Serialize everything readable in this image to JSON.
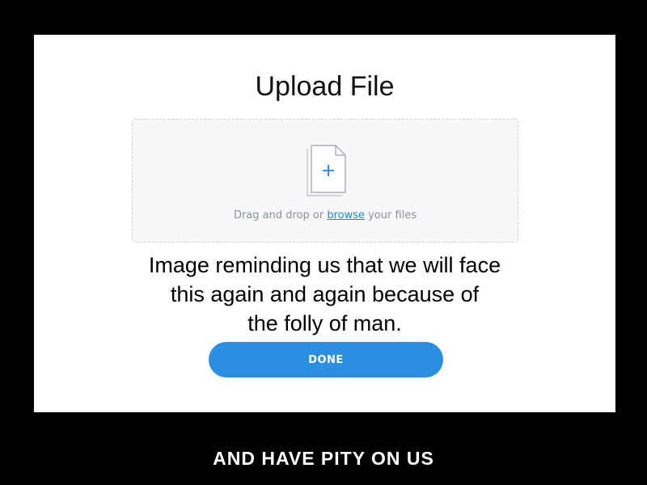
{
  "dialog": {
    "title": "Upload File",
    "dropzone": {
      "icon": "file-add-icon",
      "text_before": "Drag and drop or ",
      "browse_link": "browse",
      "text_after": " your files"
    },
    "overlay_caption": {
      "line1": "Image reminding us that we will face",
      "line2": "this again and again because of",
      "line3": "the folly of man."
    },
    "done_label": "DONE"
  },
  "bottom_caption": "AND HAVE PITY ON US",
  "colors": {
    "background": "#000000",
    "panel": "#ffffff",
    "accent": "#2a8fe0",
    "link": "#1e88e5",
    "muted_text": "#8a9099"
  }
}
